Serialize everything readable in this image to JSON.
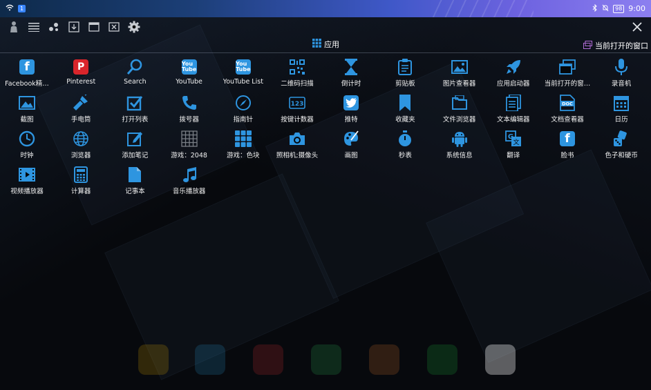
{
  "status_bar": {
    "notif_badge": "1",
    "time": "9:00",
    "battery": "98"
  },
  "toolbar": {
    "buttons": [
      "hand-icon",
      "menu-lines-icon",
      "dots-icon",
      "download-window-icon",
      "window-icon",
      "close-window-icon",
      "gear-icon"
    ],
    "close": "close-icon"
  },
  "tabs": {
    "apps_label": "应用",
    "current_windows_label": "当前打开的窗口"
  },
  "accent": "#2e95e0",
  "apps": [
    {
      "label": "Facebook精…",
      "icon": "facebook-icon"
    },
    {
      "label": "Pinterest",
      "icon": "pinterest-icon"
    },
    {
      "label": "Search",
      "icon": "search-icon"
    },
    {
      "label": "YouTube",
      "icon": "youtube-icon"
    },
    {
      "label": "YouTube List",
      "icon": "youtube-list-icon"
    },
    {
      "label": "二维码扫描",
      "icon": "qr-code-icon"
    },
    {
      "label": "倒计时",
      "icon": "hourglass-icon"
    },
    {
      "label": "剪贴板",
      "icon": "clipboard-icon"
    },
    {
      "label": "图片查看器",
      "icon": "image-icon"
    },
    {
      "label": "应用启动器",
      "icon": "rocket-icon"
    },
    {
      "label": "当前打开的窗…",
      "icon": "windows-stack-icon"
    },
    {
      "label": "录音机",
      "icon": "microphone-icon"
    },
    {
      "label": "截图",
      "icon": "screenshot-icon"
    },
    {
      "label": "手电筒",
      "icon": "flashlight-icon"
    },
    {
      "label": "打开列表",
      "icon": "checkbox-icon"
    },
    {
      "label": "拨号器",
      "icon": "phone-icon"
    },
    {
      "label": "指南针",
      "icon": "compass-icon"
    },
    {
      "label": "按键计数器",
      "icon": "counter-icon"
    },
    {
      "label": "推特",
      "icon": "twitter-icon"
    },
    {
      "label": "收藏夹",
      "icon": "bookmark-icon"
    },
    {
      "label": "文件浏览器",
      "icon": "folder-icon"
    },
    {
      "label": "文本编辑器",
      "icon": "text-editor-icon"
    },
    {
      "label": "文档查看器",
      "icon": "doc-icon"
    },
    {
      "label": "日历",
      "icon": "calendar-icon"
    },
    {
      "label": "时钟",
      "icon": "clock-icon"
    },
    {
      "label": "浏览器",
      "icon": "globe-icon"
    },
    {
      "label": "添加笔记",
      "icon": "note-add-icon"
    },
    {
      "label": "游戏：2048",
      "icon": "grid-game-icon"
    },
    {
      "label": "游戏：色块",
      "icon": "color-blocks-icon"
    },
    {
      "label": "照相机;摄像头",
      "icon": "camera-icon"
    },
    {
      "label": "画图",
      "icon": "paint-icon"
    },
    {
      "label": "秒表",
      "icon": "stopwatch-icon"
    },
    {
      "label": "系统信息",
      "icon": "android-icon"
    },
    {
      "label": "翻译",
      "icon": "translate-icon"
    },
    {
      "label": "脸书",
      "icon": "facebook-icon"
    },
    {
      "label": "色子和硬币",
      "icon": "dice-icon"
    },
    {
      "label": "视频播放器",
      "icon": "film-icon"
    },
    {
      "label": "计算器",
      "icon": "calculator-icon"
    },
    {
      "label": "记事本",
      "icon": "notepad-icon"
    },
    {
      "label": "音乐播放器",
      "icon": "music-icon"
    }
  ]
}
